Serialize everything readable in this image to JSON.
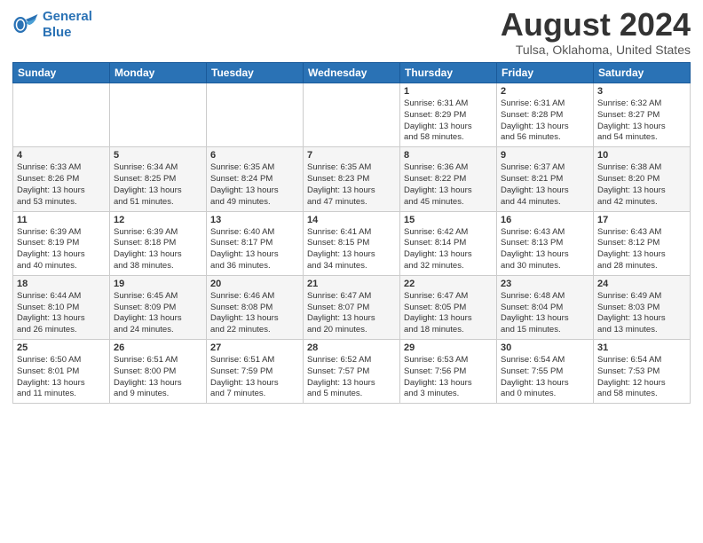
{
  "header": {
    "logo_line1": "General",
    "logo_line2": "Blue",
    "cal_title": "August 2024",
    "cal_subtitle": "Tulsa, Oklahoma, United States"
  },
  "days_of_week": [
    "Sunday",
    "Monday",
    "Tuesday",
    "Wednesday",
    "Thursday",
    "Friday",
    "Saturday"
  ],
  "weeks": [
    [
      {
        "day": "",
        "info": ""
      },
      {
        "day": "",
        "info": ""
      },
      {
        "day": "",
        "info": ""
      },
      {
        "day": "",
        "info": ""
      },
      {
        "day": "1",
        "info": "Sunrise: 6:31 AM\nSunset: 8:29 PM\nDaylight: 13 hours\nand 58 minutes."
      },
      {
        "day": "2",
        "info": "Sunrise: 6:31 AM\nSunset: 8:28 PM\nDaylight: 13 hours\nand 56 minutes."
      },
      {
        "day": "3",
        "info": "Sunrise: 6:32 AM\nSunset: 8:27 PM\nDaylight: 13 hours\nand 54 minutes."
      }
    ],
    [
      {
        "day": "4",
        "info": "Sunrise: 6:33 AM\nSunset: 8:26 PM\nDaylight: 13 hours\nand 53 minutes."
      },
      {
        "day": "5",
        "info": "Sunrise: 6:34 AM\nSunset: 8:25 PM\nDaylight: 13 hours\nand 51 minutes."
      },
      {
        "day": "6",
        "info": "Sunrise: 6:35 AM\nSunset: 8:24 PM\nDaylight: 13 hours\nand 49 minutes."
      },
      {
        "day": "7",
        "info": "Sunrise: 6:35 AM\nSunset: 8:23 PM\nDaylight: 13 hours\nand 47 minutes."
      },
      {
        "day": "8",
        "info": "Sunrise: 6:36 AM\nSunset: 8:22 PM\nDaylight: 13 hours\nand 45 minutes."
      },
      {
        "day": "9",
        "info": "Sunrise: 6:37 AM\nSunset: 8:21 PM\nDaylight: 13 hours\nand 44 minutes."
      },
      {
        "day": "10",
        "info": "Sunrise: 6:38 AM\nSunset: 8:20 PM\nDaylight: 13 hours\nand 42 minutes."
      }
    ],
    [
      {
        "day": "11",
        "info": "Sunrise: 6:39 AM\nSunset: 8:19 PM\nDaylight: 13 hours\nand 40 minutes."
      },
      {
        "day": "12",
        "info": "Sunrise: 6:39 AM\nSunset: 8:18 PM\nDaylight: 13 hours\nand 38 minutes."
      },
      {
        "day": "13",
        "info": "Sunrise: 6:40 AM\nSunset: 8:17 PM\nDaylight: 13 hours\nand 36 minutes."
      },
      {
        "day": "14",
        "info": "Sunrise: 6:41 AM\nSunset: 8:15 PM\nDaylight: 13 hours\nand 34 minutes."
      },
      {
        "day": "15",
        "info": "Sunrise: 6:42 AM\nSunset: 8:14 PM\nDaylight: 13 hours\nand 32 minutes."
      },
      {
        "day": "16",
        "info": "Sunrise: 6:43 AM\nSunset: 8:13 PM\nDaylight: 13 hours\nand 30 minutes."
      },
      {
        "day": "17",
        "info": "Sunrise: 6:43 AM\nSunset: 8:12 PM\nDaylight: 13 hours\nand 28 minutes."
      }
    ],
    [
      {
        "day": "18",
        "info": "Sunrise: 6:44 AM\nSunset: 8:10 PM\nDaylight: 13 hours\nand 26 minutes."
      },
      {
        "day": "19",
        "info": "Sunrise: 6:45 AM\nSunset: 8:09 PM\nDaylight: 13 hours\nand 24 minutes."
      },
      {
        "day": "20",
        "info": "Sunrise: 6:46 AM\nSunset: 8:08 PM\nDaylight: 13 hours\nand 22 minutes."
      },
      {
        "day": "21",
        "info": "Sunrise: 6:47 AM\nSunset: 8:07 PM\nDaylight: 13 hours\nand 20 minutes."
      },
      {
        "day": "22",
        "info": "Sunrise: 6:47 AM\nSunset: 8:05 PM\nDaylight: 13 hours\nand 18 minutes."
      },
      {
        "day": "23",
        "info": "Sunrise: 6:48 AM\nSunset: 8:04 PM\nDaylight: 13 hours\nand 15 minutes."
      },
      {
        "day": "24",
        "info": "Sunrise: 6:49 AM\nSunset: 8:03 PM\nDaylight: 13 hours\nand 13 minutes."
      }
    ],
    [
      {
        "day": "25",
        "info": "Sunrise: 6:50 AM\nSunset: 8:01 PM\nDaylight: 13 hours\nand 11 minutes."
      },
      {
        "day": "26",
        "info": "Sunrise: 6:51 AM\nSunset: 8:00 PM\nDaylight: 13 hours\nand 9 minutes."
      },
      {
        "day": "27",
        "info": "Sunrise: 6:51 AM\nSunset: 7:59 PM\nDaylight: 13 hours\nand 7 minutes."
      },
      {
        "day": "28",
        "info": "Sunrise: 6:52 AM\nSunset: 7:57 PM\nDaylight: 13 hours\nand 5 minutes."
      },
      {
        "day": "29",
        "info": "Sunrise: 6:53 AM\nSunset: 7:56 PM\nDaylight: 13 hours\nand 3 minutes."
      },
      {
        "day": "30",
        "info": "Sunrise: 6:54 AM\nSunset: 7:55 PM\nDaylight: 13 hours\nand 0 minutes."
      },
      {
        "day": "31",
        "info": "Sunrise: 6:54 AM\nSunset: 7:53 PM\nDaylight: 12 hours\nand 58 minutes."
      }
    ]
  ]
}
